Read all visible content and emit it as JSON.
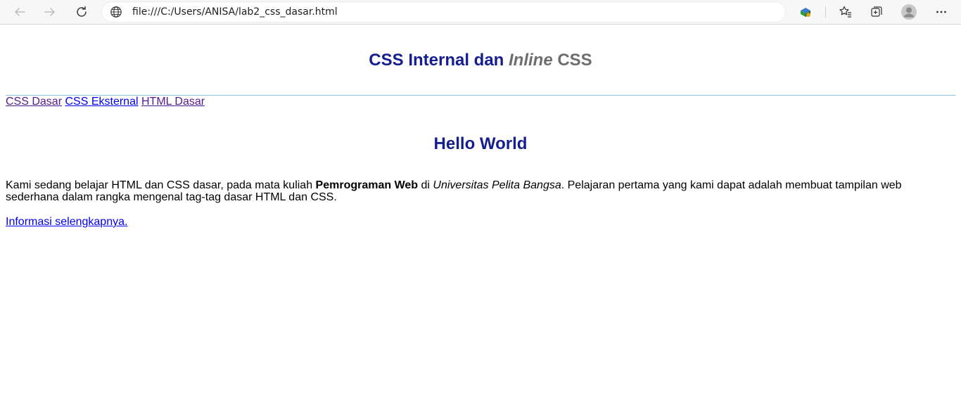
{
  "browser": {
    "url": "file:///C:/Users/ANISA/lab2_css_dasar.html",
    "icons": [
      "back-arrow-icon",
      "forward-arrow-icon",
      "refresh-icon",
      "globe-icon",
      "extension-icon",
      "favorites-star-icon",
      "collections-icon",
      "profile-icon",
      "more-icon"
    ]
  },
  "header": {
    "title_part1": "CSS Internal dan ",
    "title_italic": "Inline",
    "title_part2": " CSS"
  },
  "nav": {
    "links": [
      "CSS Dasar",
      "CSS Eksternal",
      "HTML Dasar"
    ]
  },
  "main": {
    "heading": "Hello World",
    "para_1": "Kami sedang belajar HTML dan CSS dasar, pada mata kuliah ",
    "para_bold": "Pemrograman Web",
    "para_2": " di ",
    "para_italic": "Universitas Pelita Bangsa",
    "para_3": ". Pelajaran pertama yang kami dapat adalah membuat tampilan web sederhana dalam rangka mengenal tag-tag dasar HTML dan CSS.",
    "more_link": "Informasi selengkapnya."
  },
  "colors": {
    "heading": "#151e8f",
    "italic_grey": "#6e6e6e",
    "rule": "#8fc2dc",
    "link": "#0000ee",
    "visited": "#551a8b"
  }
}
